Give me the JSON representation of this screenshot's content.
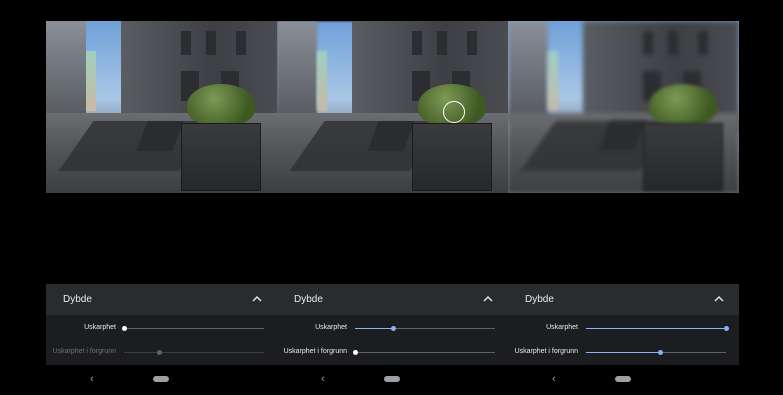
{
  "panels": [
    {
      "sheet_title": "Dybde",
      "sharpness_label": "Uskarphet",
      "sharpness_value": 0.0,
      "fg_label": "Uskarphet i forgrunn",
      "fg_value": 0.25,
      "fg_disabled": true,
      "focus_ring": false,
      "blur": "near"
    },
    {
      "sheet_title": "Dybde",
      "sharpness_label": "Uskarphet",
      "sharpness_value": 0.27,
      "fg_label": "Uskarphet i forgrunn",
      "fg_value": 0.0,
      "fg_disabled": false,
      "focus_ring": true,
      "blur": "mid"
    },
    {
      "sheet_title": "Dybde",
      "sharpness_label": "Uskarphet",
      "sharpness_value": 1.0,
      "fg_label": "Uskarphet i forgrunn",
      "fg_value": 0.53,
      "fg_disabled": false,
      "focus_ring": false,
      "blur": "far"
    }
  ],
  "icons": {
    "collapse": "chevron-up-icon",
    "back": "back-triangle-icon",
    "home": "home-pill-icon"
  },
  "colors": {
    "accent": "#8ab4f8",
    "track": "#5f6368",
    "sheet_header": "#2a2b2f",
    "sheet_body": "#1c1d20"
  },
  "nav": {
    "back_glyph": "‹"
  }
}
